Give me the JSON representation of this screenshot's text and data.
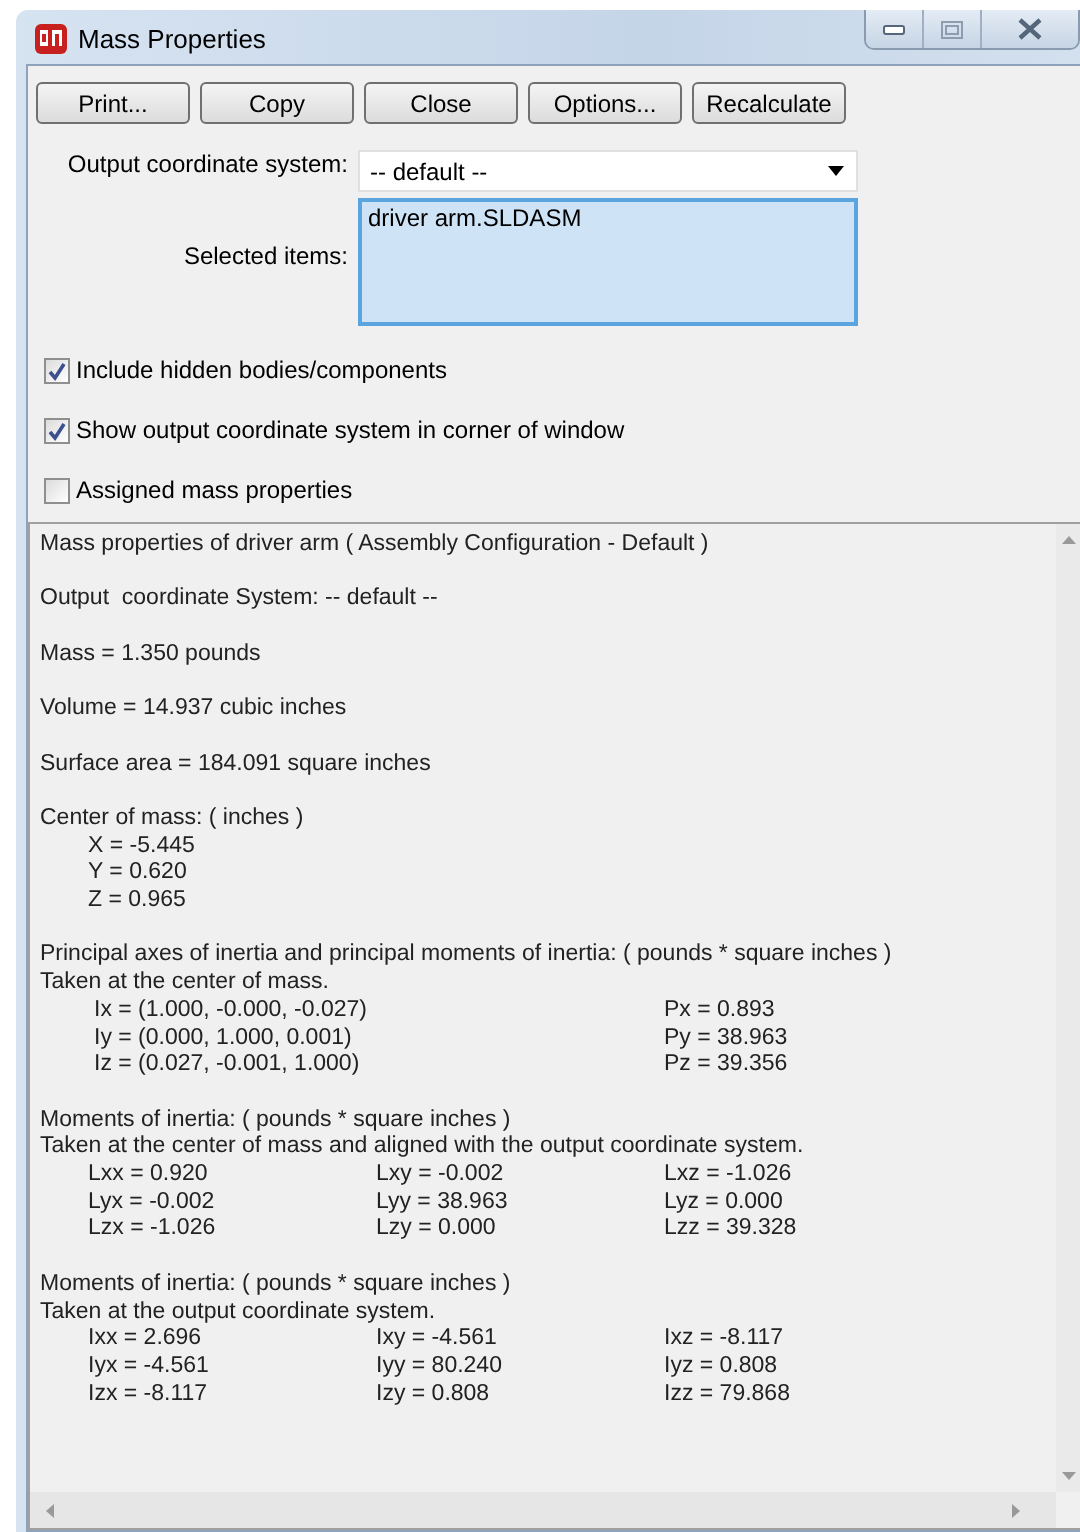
{
  "window": {
    "title": "Mass Properties"
  },
  "toolbar": [
    "Print...",
    "Copy",
    "Close",
    "Options...",
    "Recalculate"
  ],
  "output_coordinate_system": {
    "label": "Output coordinate system:",
    "value": "-- default --"
  },
  "selected_items": {
    "label": "Selected items:",
    "items": [
      "driver arm.SLDASM"
    ]
  },
  "checkboxes": [
    {
      "label": "Include hidden bodies/components",
      "checked": true
    },
    {
      "label": "Show output coordinate system in corner of window",
      "checked": true
    },
    {
      "label": "Assigned mass properties",
      "checked": false
    }
  ],
  "report": [
    {
      "lines": [
        "Mass properties of driver arm ( Assembly Configuration - Default )"
      ]
    },
    {
      "lines": [
        "Output  coordinate System: -- default --"
      ]
    },
    {
      "lines": [
        "Mass = 1.350 pounds"
      ]
    },
    {
      "lines": [
        "Volume = 14.937 cubic inches"
      ]
    },
    {
      "lines": [
        "Surface area = 184.091 square inches"
      ]
    },
    {
      "lines": [
        "Center of mass: ( inches )"
      ],
      "rows": [
        [
          "X = -5.445"
        ],
        [
          "Y = 0.620"
        ],
        [
          "Z = 0.965"
        ]
      ]
    },
    {
      "lines": [
        "Principal axes of inertia and principal moments of inertia: ( pounds * square inches )",
        "Taken at the center of mass."
      ],
      "rows": [
        [
          "Ix = (1.000, -0.000, -0.027)",
          "Px = 0.893"
        ],
        [
          "Iy = (0.000, 1.000, 0.001)",
          "Py = 38.963"
        ],
        [
          "Iz = (0.027, -0.001, 1.000)",
          "Pz = 39.356"
        ]
      ]
    },
    {
      "lines": [
        "Moments of inertia: ( pounds * square inches )",
        "Taken at the center of mass and aligned with the output coordinate system."
      ],
      "rows": [
        [
          "Lxx = 0.920",
          "Lxy = -0.002",
          "Lxz = -1.026"
        ],
        [
          "Lyx = -0.002",
          "Lyy = 38.963",
          "Lyz = 0.000"
        ],
        [
          "Lzx = -1.026",
          "Lzy = 0.000",
          "Lzz = 39.328"
        ]
      ]
    },
    {
      "lines": [
        "Moments of inertia: ( pounds * square inches )",
        "Taken at the output coordinate system."
      ],
      "rows": [
        [
          "Ixx = 2.696",
          "Ixy = -4.561",
          "Ixz = -8.117"
        ],
        [
          "Iyx = -4.561",
          "Iyy = 80.240",
          "Iyz = 0.808"
        ],
        [
          "Izx = -8.117",
          "Izy = 0.808",
          "Izz = 79.868"
        ]
      ]
    }
  ]
}
